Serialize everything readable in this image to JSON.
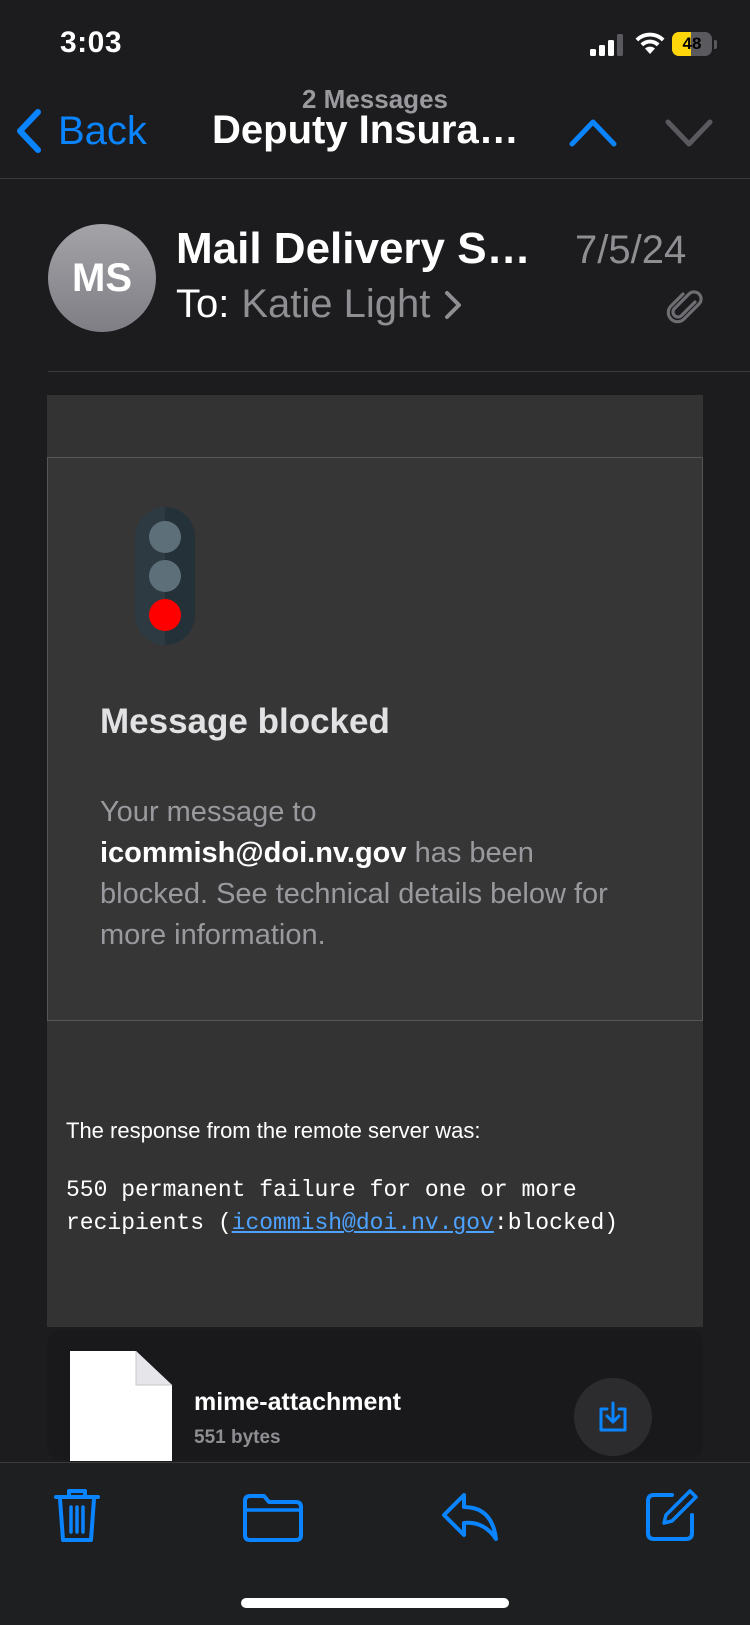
{
  "status_bar": {
    "time": "3:03",
    "battery_level": "48",
    "battery_fraction": 0.48
  },
  "nav": {
    "back_label": "Back",
    "subtitle": "2 Messages",
    "title": "Deputy Insurance Commissioner"
  },
  "header": {
    "avatar_initials": "MS",
    "sender": "Mail Delivery Subsystem",
    "date": "7/5/24",
    "to_label": "To:",
    "recipient": "Katie Light"
  },
  "body": {
    "title": "Message blocked",
    "desc_prefix": "Your message to",
    "blocked_address": "icommish@doi.nv.gov",
    "desc_suffix": "has been blocked. See technical details below for more information.",
    "response_label": "The response from the remote server was:",
    "response_code_prefix": "550 permanent failure for one or more recipients (",
    "response_code_link": "icommish@doi.nv.gov",
    "response_code_suffix": ":blocked)"
  },
  "attachment": {
    "name": "mime-attachment",
    "size": "551 bytes"
  },
  "toolbar": {
    "icons": [
      "trash-icon",
      "folder-icon",
      "reply-icon",
      "compose-icon"
    ]
  },
  "colors": {
    "accent": "#0a84ff",
    "background": "#1c1c1e",
    "signal_red": "#ff0000",
    "battery": "#ffd60a"
  }
}
